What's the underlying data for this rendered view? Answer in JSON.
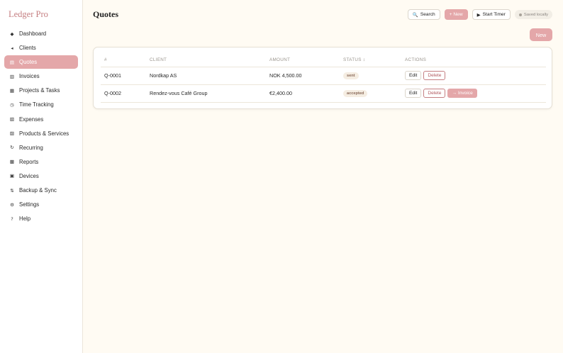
{
  "app": {
    "brand": "Ledger Pro",
    "accent": "#e4a7a9"
  },
  "sidebar": {
    "items": [
      {
        "label": "Dashboard",
        "icon": "◆"
      },
      {
        "label": "Clients",
        "icon": "◂"
      },
      {
        "label": "Quotes",
        "icon": "▤"
      },
      {
        "label": "Invoices",
        "icon": "▥"
      },
      {
        "label": "Projects & Tasks",
        "icon": "▦"
      },
      {
        "label": "Time Tracking",
        "icon": "◷"
      },
      {
        "label": "Expenses",
        "icon": "▧"
      },
      {
        "label": "Products & Services",
        "icon": "▨"
      },
      {
        "label": "Recurring",
        "icon": "↻"
      },
      {
        "label": "Reports",
        "icon": "▩"
      },
      {
        "label": "Devices",
        "icon": "▣"
      },
      {
        "label": "Backup & Sync",
        "icon": "⇅"
      },
      {
        "label": "Settings",
        "icon": "⚙"
      },
      {
        "label": "Help",
        "icon": "?"
      }
    ],
    "active_label": "Quotes"
  },
  "header": {
    "title": "Quotes",
    "search_label": "Search",
    "search_icon": "🔍",
    "new_label": "+ New",
    "timer_label": "Start Timer",
    "timer_icon": "▶",
    "saved_label": "Saved locally"
  },
  "main": {
    "new_button_label": "New"
  },
  "table": {
    "columns": [
      "#",
      "CLIENT",
      "AMOUNT",
      "STATUS ↕",
      "ACTIONS"
    ],
    "rows": [
      {
        "number": "Q-0001",
        "client": "Nordkap AS",
        "amount": "NOK 4,500.00",
        "status": "sent",
        "actions": [
          "Edit",
          "Delete"
        ]
      },
      {
        "number": "Q-0002",
        "client": "Rendez-vous Café Group",
        "amount": "€2,400.00",
        "status": "accepted",
        "actions": [
          "Edit",
          "Delete",
          "→ Invoice"
        ]
      }
    ]
  }
}
